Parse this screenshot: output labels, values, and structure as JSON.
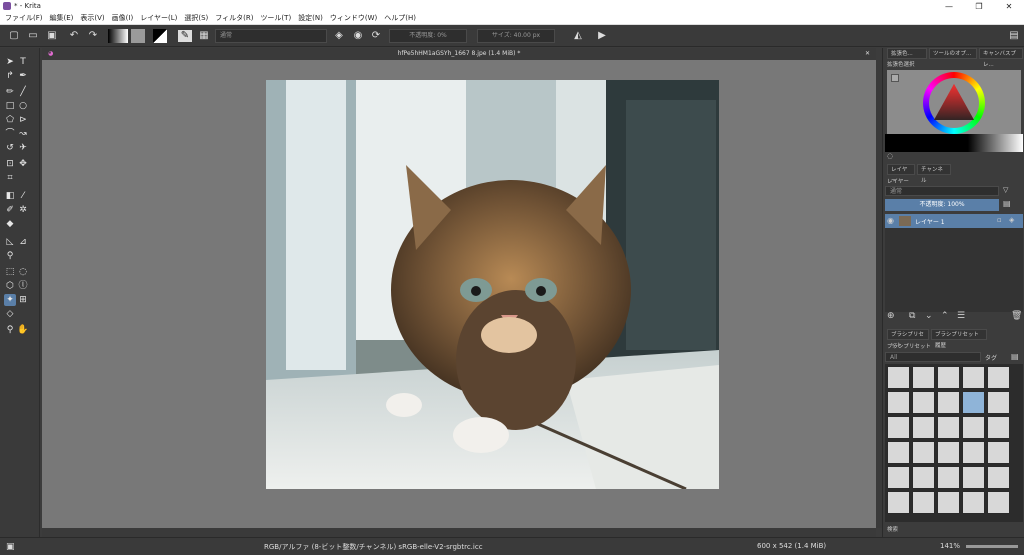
{
  "window": {
    "title": "* - Krita",
    "minimize": "—",
    "maximize": "❐",
    "close": "✕"
  },
  "menu": [
    "ファイル(F)",
    "編集(E)",
    "表示(V)",
    "画像(I)",
    "レイヤー(L)",
    "選択(S)",
    "フィルタ(R)",
    "ツール(T)",
    "設定(N)",
    "ウィンドウ(W)",
    "ヘルプ(H)"
  ],
  "toolbar": {
    "blend_mode": "通常",
    "opacity": "不透明度: 0%",
    "size": "サイズ: 40.00 px"
  },
  "document_tab": "hfPe5hHM1aGSYh_1667 8.jpe (1.4 MiB) *",
  "docker": {
    "top_tabs": [
      "拡張色...",
      "ツールのオプ...",
      "キャンバスプレ..."
    ],
    "color_selector_title": "拡張色選択",
    "layer_tabs": [
      "レイヤー",
      "チャンネル"
    ],
    "layers_title": "レイヤー",
    "layer_blend": "通常",
    "layer_opacity": "不透明度: 100%",
    "layer_name": "レイヤー 1",
    "brush_tabs": [
      "ブラシプリセット",
      "ブラシプリセット履歴"
    ],
    "brush_title": "ブラシプリセット",
    "brush_filter": "All",
    "brush_tag": "タグ",
    "brush_search": "検索"
  },
  "status": {
    "color_space": "RGB/アルファ (8-ビット整数/チャンネル)  sRGB-elle-V2-srgbtrc.icc",
    "image_size": "600 x 542 (1.4 MiB)",
    "zoom": "141%"
  }
}
